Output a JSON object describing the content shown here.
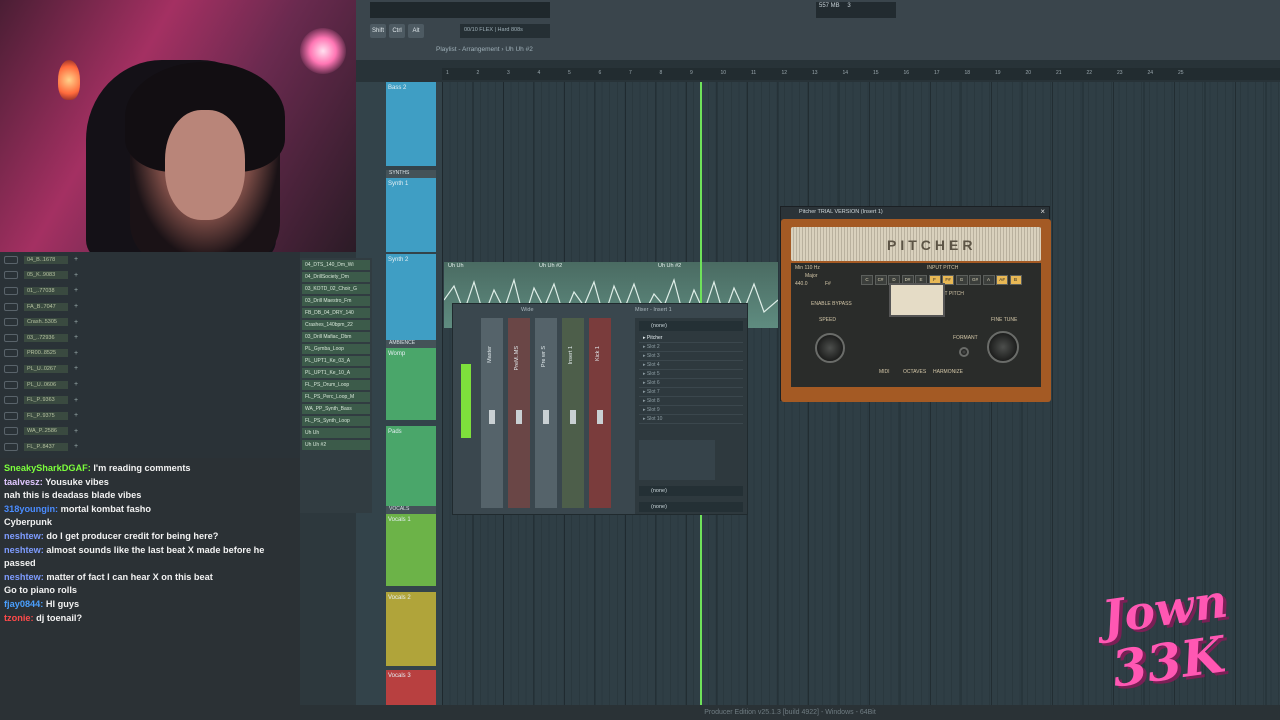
{
  "toolbar": {
    "memory": "557 MB",
    "voices": "3",
    "keys": [
      "Shift",
      "Ctrl",
      "Alt"
    ],
    "pattern": "00/10 FLEX | Hard 808s",
    "breadcrumb": "Playlist - Arrangement › Uh Uh #2"
  },
  "ruler": [
    "1",
    "2",
    "3",
    "4",
    "5",
    "6",
    "7",
    "8",
    "9",
    "10",
    "11",
    "12",
    "13",
    "14",
    "15",
    "16",
    "17",
    "18",
    "19",
    "20",
    "21",
    "22",
    "23",
    "24",
    "25"
  ],
  "browser_items": [
    "04_B..1678",
    "05_K..9083",
    "01_..77038",
    "FA_B..7047",
    "Crash..5305",
    "03_..72936",
    "PR00..8525",
    "PL_U..0267",
    "PL_U..0606",
    "FL_P..9363",
    "FL_P..9375",
    "WA_P..2586",
    "FL_P..8437"
  ],
  "patterns": [
    "04_DTS_140_Dm_Wi",
    "04_DrillSociety_Dm",
    "03_KOTD_02_Choir_G",
    "03_Drill Maestro_Fm",
    "FB_DB_04_DRY_140",
    "Crashes_140bpm_22",
    "03_Drill Mafiac_Dbm",
    "PL_Gymba_Loop",
    "PL_UPT1_Ke_03_A",
    "PL_UPT1_Ke_10_A",
    "FL_PS_Drum_Loop",
    "FL_PS_Perc_Loop_M",
    "WA_PP_Synth_Bass",
    "FL_PS_Synth_Loop",
    "Uh Uh",
    "Uh Uh #2"
  ],
  "tracks": [
    {
      "name": "Bass 2",
      "color": "#3f9ec4"
    },
    {
      "name": "Synth 1",
      "color": "#3f9ec4"
    },
    {
      "name": "Synth 2",
      "color": "#3f9ec4"
    },
    {
      "name": "Womp",
      "color": "#4aa66a"
    },
    {
      "name": "Pads",
      "color": "#4aa66a"
    },
    {
      "name": "Vocals 1",
      "color": "#6cb348"
    },
    {
      "name": "Vocals 2",
      "color": "#b0a43a"
    },
    {
      "name": "Vocals 3",
      "color": "#b84040"
    }
  ],
  "group_labels": {
    "synths": "SYNTHS",
    "ambience": "AMBIENCE",
    "vocals": "VOCALS"
  },
  "clip": {
    "title1": "Uh Uh",
    "title2": "Uh Uh #2",
    "title3": "Uh Uh #2",
    "title4": "Uh Uh #2"
  },
  "mixer": {
    "title": "Mixer - Insert 1",
    "wide_label": "Wide",
    "channels": [
      "Master",
      "PreM..MS",
      "Pre wr S",
      "Insert 1",
      "Kick 1"
    ],
    "top_slot": "(none)",
    "slots": [
      "Pitcher",
      "Slot 2",
      "Slot 3",
      "Slot 4",
      "Slot 5",
      "Slot 6",
      "Slot 7",
      "Slot 8",
      "Slot 9",
      "Slot 10"
    ],
    "bottom_slot_1": "(none)",
    "bottom_slot_2": "(none)"
  },
  "pitcher": {
    "title": "Pitcher TRIAL VERSION (Insert 1)",
    "logo": "PITCHER",
    "min_hz": "Min 110 Hz",
    "scale": "Major",
    "tuning": "440.0",
    "key": "F#",
    "input_pitch": "INPUT PITCH",
    "output_pitch": "OUTPUT PITCH",
    "enable_bypass": "ENABLE BYPASS",
    "speed": "SPEED",
    "formant": "FORMANT",
    "fine_tune": "FINE TUNE",
    "modes": [
      "MIDI",
      "OCTAVES",
      "HARMONIZE"
    ],
    "notes": [
      "C",
      "C#",
      "D",
      "D#",
      "E",
      "F",
      "F#",
      "G",
      "G#",
      "A",
      "A#",
      "B"
    ],
    "active_notes": [
      "F",
      "F#",
      "A#",
      "B"
    ]
  },
  "chat": [
    {
      "user": "SneakySharkDGAF",
      "color": "#7cff3c",
      "text": "I'm reading comments"
    },
    {
      "user": "taalvesz",
      "color": "#e0c7ff",
      "text": "Yousuke vibes"
    },
    {
      "user": "",
      "color": "#ff4040",
      "text": "nah this is deadass blade vibes"
    },
    {
      "user": "318youngin",
      "color": "#4a8cff",
      "text": "mortal kombat fasho"
    },
    {
      "user": "",
      "color": "#3fbf3f",
      "text": "Cyberpunk"
    },
    {
      "user": "neshtew",
      "color": "#7e9cff",
      "text": "do I get producer credit for being here?"
    },
    {
      "user": "neshtew",
      "color": "#7e9cff",
      "text": "almost sounds like the last beat X made before he passed"
    },
    {
      "user": "neshtew",
      "color": "#7e9cff",
      "text": "matter of fact I can hear X on this beat"
    },
    {
      "user": "",
      "color": "#3fbf3f",
      "text": "Go to piano rolls"
    },
    {
      "user": "fjay0844",
      "color": "#4aa0ff",
      "text": "HI guys"
    },
    {
      "user": "tzonie",
      "color": "#ff4a4a",
      "text": "dj toenail?"
    }
  ],
  "watermark": {
    "line1": "Jown",
    "line2": "33K"
  },
  "status": "Producer Edition v25.1.3 [build 4922] - Windows - 64Bit"
}
